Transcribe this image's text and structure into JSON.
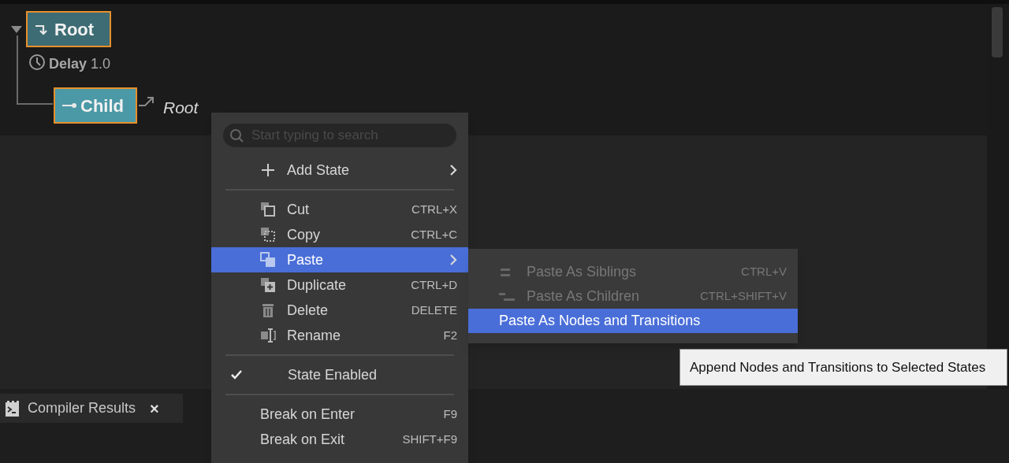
{
  "graph": {
    "root": {
      "label": "Root",
      "selected": true,
      "expanded": true
    },
    "delay": "**Delay** 1.0",
    "child": {
      "label": "Child",
      "selected": true
    },
    "transition_target": "Root"
  },
  "context_menu": {
    "search": {
      "placeholder": "Start typing to search"
    },
    "items": [
      {
        "kind": "item",
        "label": "Add State",
        "submenu": true,
        "selected": false
      },
      {
        "kind": "separator"
      },
      {
        "kind": "item",
        "label": "Cut",
        "shortcut": "CTRL+X",
        "selected": false
      },
      {
        "kind": "item",
        "label": "Copy",
        "shortcut": "CTRL+C",
        "selected": false
      },
      {
        "kind": "item",
        "label": "Paste",
        "submenu": true,
        "selected": true
      },
      {
        "kind": "item",
        "label": "Duplicate",
        "shortcut": "CTRL+D",
        "selected": false
      },
      {
        "kind": "item",
        "label": "Delete",
        "shortcut": "DELETE",
        "selected": false
      },
      {
        "kind": "item",
        "label": "Rename",
        "shortcut": "F2",
        "selected": false
      },
      {
        "kind": "separator"
      },
      {
        "kind": "check",
        "label": "State Enabled",
        "checked": true,
        "selected": false
      },
      {
        "kind": "separator"
      },
      {
        "kind": "plain",
        "label": "Break on Enter",
        "shortcut": "F9",
        "selected": false
      },
      {
        "kind": "plain",
        "label": "Break on Exit",
        "shortcut": "SHIFT+F9",
        "selected": false
      }
    ]
  },
  "submenu": {
    "items": [
      {
        "label": "Paste As Siblings",
        "shortcut": "CTRL+V",
        "disabled": true,
        "selected": false,
        "icon": true
      },
      {
        "label": "Paste As Children",
        "shortcut": "CTRL+SHIFT+V",
        "disabled": true,
        "selected": false,
        "icon": true
      },
      {
        "label": "Paste As Nodes and Transitions",
        "disabled": false,
        "selected": true,
        "icon": false
      }
    ]
  },
  "tooltip": "Append Nodes and Transitions to Selected States",
  "bottom_panel": {
    "tab": {
      "label": "Compiler Results",
      "close": "×"
    }
  }
}
